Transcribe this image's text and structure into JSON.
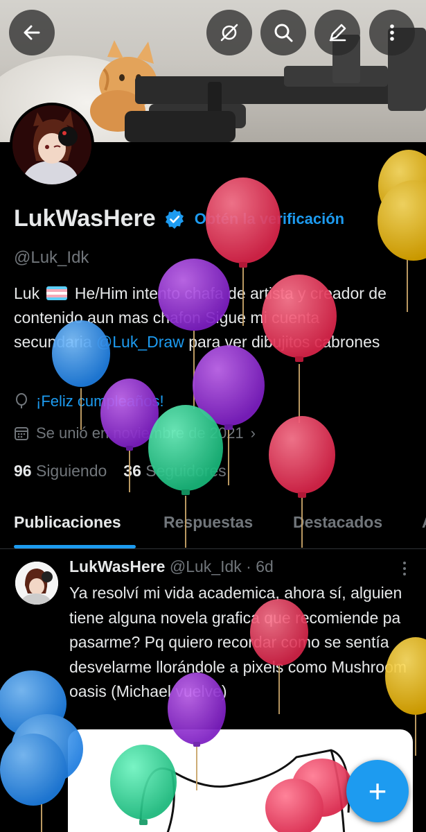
{
  "header": {
    "buttons": [
      {
        "name": "back-button",
        "icon": "arrow-left-icon"
      },
      {
        "name": "grok-button",
        "icon": "grok-slash-icon"
      },
      {
        "name": "search-button",
        "icon": "search-icon"
      },
      {
        "name": "edit-button",
        "icon": "pencil-icon"
      },
      {
        "name": "more-button",
        "icon": "more-vertical-icon"
      }
    ]
  },
  "profile": {
    "name": "LukWasHere",
    "verify_cta": "Obtén la verificación",
    "handle": "@Luk_Idk",
    "bio_part1": "Luk",
    "bio_part2": "He/Him intento chafa de artista y creador de contenido aun mas chafon Sigue mi cuenta secundaria",
    "bio_mention": "@Luk_Draw",
    "bio_part3": "para ver dibujitos cabrones",
    "birthday": "¡Feliz cumpleaños!",
    "joined": "Se unió en noviembre de 2021",
    "following_count": "96",
    "following_label": "Siguiendo",
    "followers_count": "36",
    "followers_label": "Seguidores"
  },
  "tabs": [
    "Publicaciones",
    "Respuestas",
    "Destacados",
    "A"
  ],
  "post": {
    "author": "LukWasHere",
    "handle_time": "@Luk_Idk · 6d",
    "text": "Ya resolví mi vida academica, ahora sí, alguien tiene alguna novela grafica que recomiende pa pasarme? Pq quiero recordar como se sentía desvelarme llorándole a pixels como Mushroom oasis (Michael vuelve)"
  },
  "fab": {
    "label": "+"
  },
  "colors": {
    "accent": "#1d9bf0",
    "background": "#000000",
    "muted": "#71767b",
    "text": "#e7e9ea"
  }
}
